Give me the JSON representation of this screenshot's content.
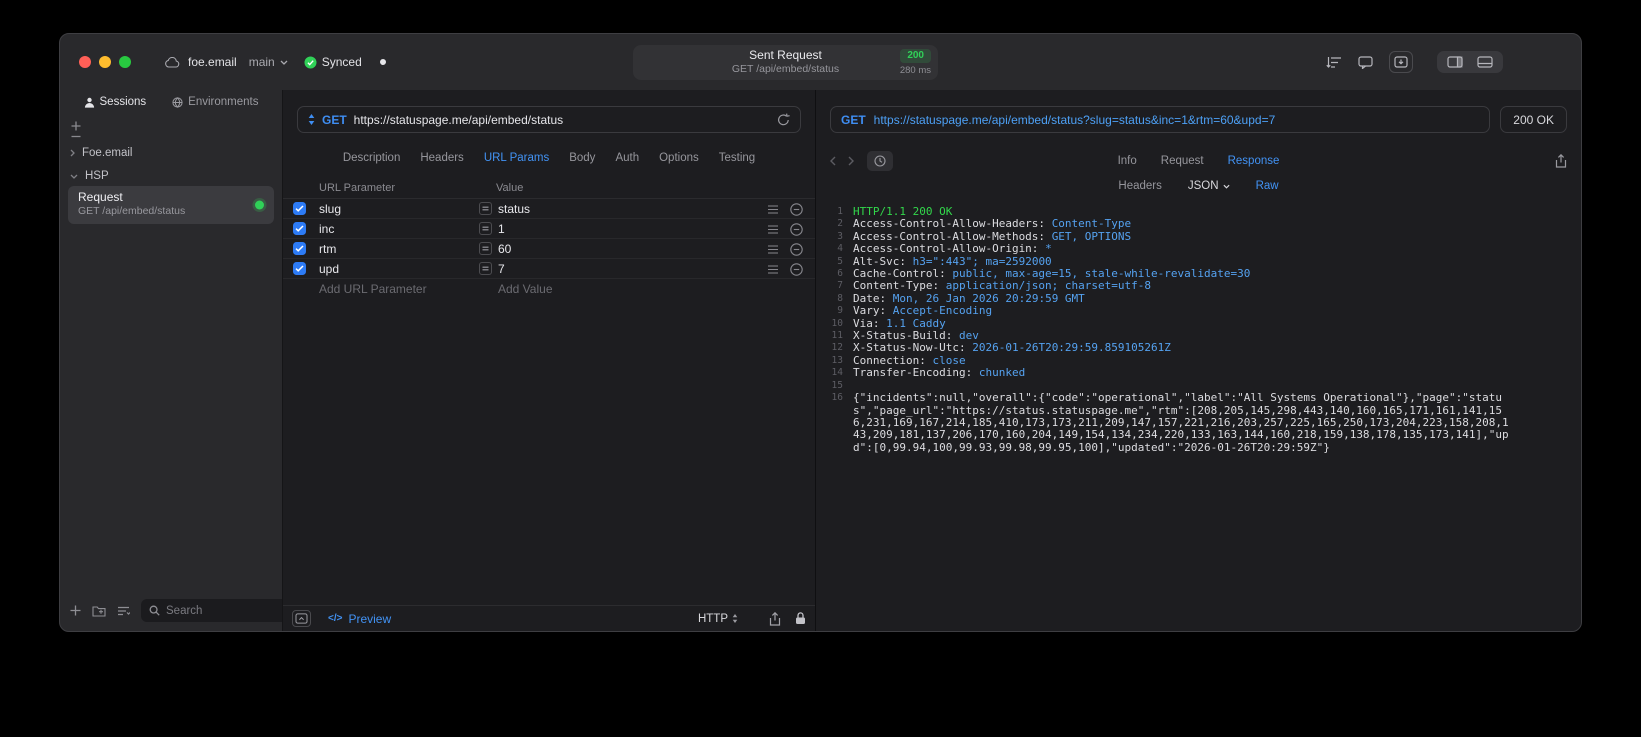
{
  "theme": {
    "accent_blue": "#4293f5",
    "code_blue": "#55a2f0",
    "success_green": "#30d158",
    "window_bg": "#29292c",
    "panel_bg": "#1d1d20"
  },
  "titlebar": {
    "project_name": "foe.email",
    "branch_name": "main",
    "sync_label": "Synced",
    "request_title": "Sent Request",
    "request_status_code": "200",
    "request_subtitle": "GET /api/embed/status",
    "request_duration": "280 ms"
  },
  "sidebar": {
    "tabs": [
      {
        "label": "Sessions"
      },
      {
        "label": "Environments"
      }
    ],
    "tree": {
      "group_collapsed": "Foe.email",
      "group_expanded": "HSP",
      "request_title": "Request",
      "request_subtitle": "GET /api/embed/status"
    },
    "search_placeholder": "Search"
  },
  "request_panel": {
    "method": "GET",
    "url": "https://statuspage.me/api/embed/status",
    "tabs": [
      "Description",
      "Headers",
      "URL Params",
      "Body",
      "Auth",
      "Options",
      "Testing"
    ],
    "active_tab": "URL Params",
    "table": {
      "param_header": "URL Parameter",
      "value_header": "Value",
      "rows": [
        {
          "name": "slug",
          "value": "status",
          "enabled": true
        },
        {
          "name": "inc",
          "value": "1",
          "enabled": true
        },
        {
          "name": "rtm",
          "value": "60",
          "enabled": true
        },
        {
          "name": "upd",
          "value": "7",
          "enabled": true
        }
      ],
      "add_param_label": "Add URL Parameter",
      "add_value_label": "Add Value"
    },
    "footer": {
      "preview_icon": "</>",
      "preview_label": "Preview",
      "protocol_label": "HTTP"
    }
  },
  "response_panel": {
    "method": "GET",
    "url": "https://statuspage.me/api/embed/status?slug=status&inc=1&rtm=60&upd=7",
    "status_label": "200 OK",
    "tabs": [
      "Info",
      "Request",
      "Response"
    ],
    "active_tab": "Response",
    "view_tabs": [
      "Headers",
      "JSON",
      "Raw"
    ],
    "active_view": "Raw",
    "body_lines": [
      {
        "num": "1",
        "text": "HTTP/1.1 200 OK"
      },
      {
        "num": "2",
        "name": "Access-Control-Allow-Headers: ",
        "value": "Content-Type"
      },
      {
        "num": "3",
        "name": "Access-Control-Allow-Methods: ",
        "value": "GET, OPTIONS"
      },
      {
        "num": "4",
        "name": "Access-Control-Allow-Origin: ",
        "value": "*"
      },
      {
        "num": "5",
        "name": "Alt-Svc: ",
        "value": "h3=\":443\"; ma=2592000"
      },
      {
        "num": "6",
        "name": "Cache-Control: ",
        "value": "public, max-age=15, stale-while-revalidate=30"
      },
      {
        "num": "7",
        "name": "Content-Type: ",
        "value": "application/json; charset=utf-8"
      },
      {
        "num": "8",
        "name": "Date: ",
        "value": "Mon, 26 Jan 2026 20:29:59 GMT"
      },
      {
        "num": "9",
        "name": "Vary: ",
        "value": "Accept-Encoding"
      },
      {
        "num": "10",
        "name": "Via: ",
        "value": "1.1 Caddy"
      },
      {
        "num": "11",
        "name": "X-Status-Build: ",
        "value": "dev"
      },
      {
        "num": "12",
        "name": "X-Status-Now-Utc: ",
        "value": "2026-01-26T20:29:59.859105261Z"
      },
      {
        "num": "13",
        "name": "Connection: ",
        "value": "close"
      },
      {
        "num": "14",
        "name": "Transfer-Encoding: ",
        "value": "chunked"
      },
      {
        "num": "15",
        "text": ""
      },
      {
        "num": "16",
        "text": "{\"incidents\":null,\"overall\":{\"code\":\"operational\",\"label\":\"All Systems Operational\"},\"page\":\"status\",\"page_url\":\"https://status.statuspage.me\",\"rtm\":[208,205,145,298,443,140,160,165,171,161,141,156,231,169,167,214,185,410,173,173,211,209,147,157,221,216,203,257,225,165,250,173,204,223,158,208,143,209,181,137,206,170,160,204,149,154,134,234,220,133,163,144,160,218,159,138,178,135,173,141],\"upd\":[0,99.94,100,99.93,99.98,99.95,100],\"updated\":\"2026-01-26T20:29:59Z\"}"
      }
    ]
  }
}
